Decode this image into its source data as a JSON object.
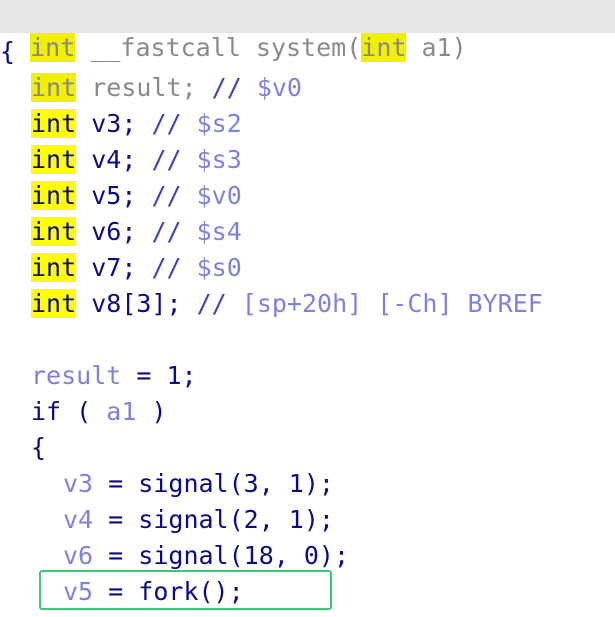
{
  "signature": {
    "return_type": "int",
    "calling_convention": "__fastcall",
    "function_name": "system",
    "open_paren": "(",
    "param_type": "int",
    "param_name": "a1",
    "close_paren": ")"
  },
  "brace_open": "{",
  "declarations": [
    {
      "type": "int",
      "name": "result",
      "sep": ";",
      "comment_slashes": "//",
      "comment_text": "$v0"
    },
    {
      "type": "int",
      "name": "v3",
      "sep": ";",
      "comment_slashes": "//",
      "comment_text": "$s2"
    },
    {
      "type": "int",
      "name": "v4",
      "sep": ";",
      "comment_slashes": "//",
      "comment_text": "$s3"
    },
    {
      "type": "int",
      "name": "v5",
      "sep": ";",
      "comment_slashes": "//",
      "comment_text": "$v0"
    },
    {
      "type": "int",
      "name": "v6",
      "sep": ";",
      "comment_slashes": "//",
      "comment_text": "$s4"
    },
    {
      "type": "int",
      "name": "v7",
      "sep": ";",
      "comment_slashes": "//",
      "comment_text": "$s0"
    },
    {
      "type": "int",
      "name": "v8[3]",
      "sep": ";",
      "comment_slashes": "//",
      "comment_text": "[sp+20h] [-Ch] BYREF"
    }
  ],
  "body": {
    "result_assign": {
      "lhs": "result",
      "op": "=",
      "rhs": "1;"
    },
    "if_stmt": {
      "keyword": "if",
      "open": "(",
      "cond": "a1",
      "close": ")"
    },
    "inner_brace": "{",
    "calls": [
      {
        "lhs": "v3",
        "op": "=",
        "rhs": "signal(3, 1);"
      },
      {
        "lhs": "v4",
        "op": "=",
        "rhs": "signal(2, 1);"
      },
      {
        "lhs": "v6",
        "op": "=",
        "rhs": "signal(18, 0);"
      },
      {
        "lhs": "v5",
        "op": "=",
        "rhs": "fork();"
      }
    ]
  },
  "colors": {
    "keyword_highlight": "#ffff00",
    "signature_background": "#e6e6e6",
    "selection_border": "#3cc878",
    "local_variable": "#8080e0",
    "code_text": "#000080"
  }
}
